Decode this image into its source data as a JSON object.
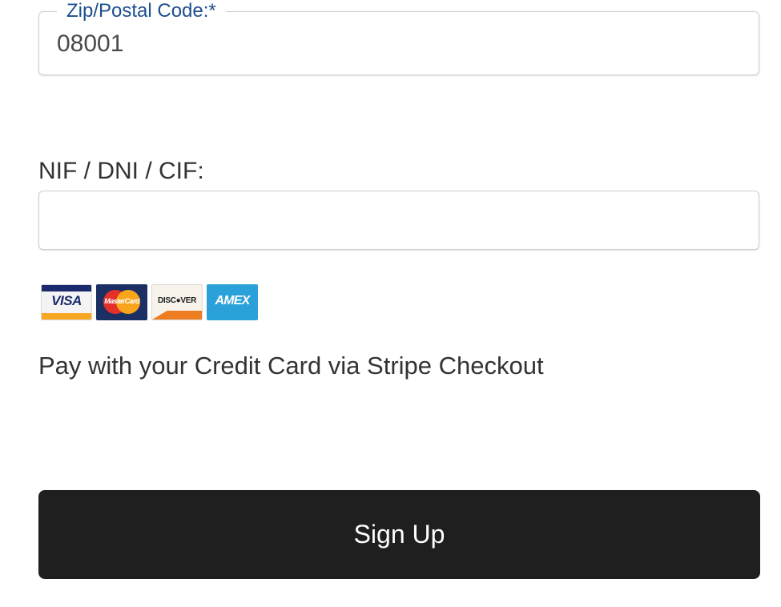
{
  "zip": {
    "label": "Zip/Postal Code:*",
    "value": "08001"
  },
  "nif": {
    "label": "NIF / DNI / CIF:",
    "value": "",
    "placeholder": ""
  },
  "cards": {
    "visa": "VISA",
    "mastercard": "MasterCard",
    "discover": "DISC●VER",
    "amex": "AMEX"
  },
  "payment": {
    "description": "Pay with your Credit Card via Stripe Checkout"
  },
  "signup": {
    "label": "Sign Up"
  },
  "colors": {
    "legend": "#1d4f8f",
    "button_bg": "#1f1f1f",
    "button_text": "#ffffff",
    "text": "#333333"
  }
}
